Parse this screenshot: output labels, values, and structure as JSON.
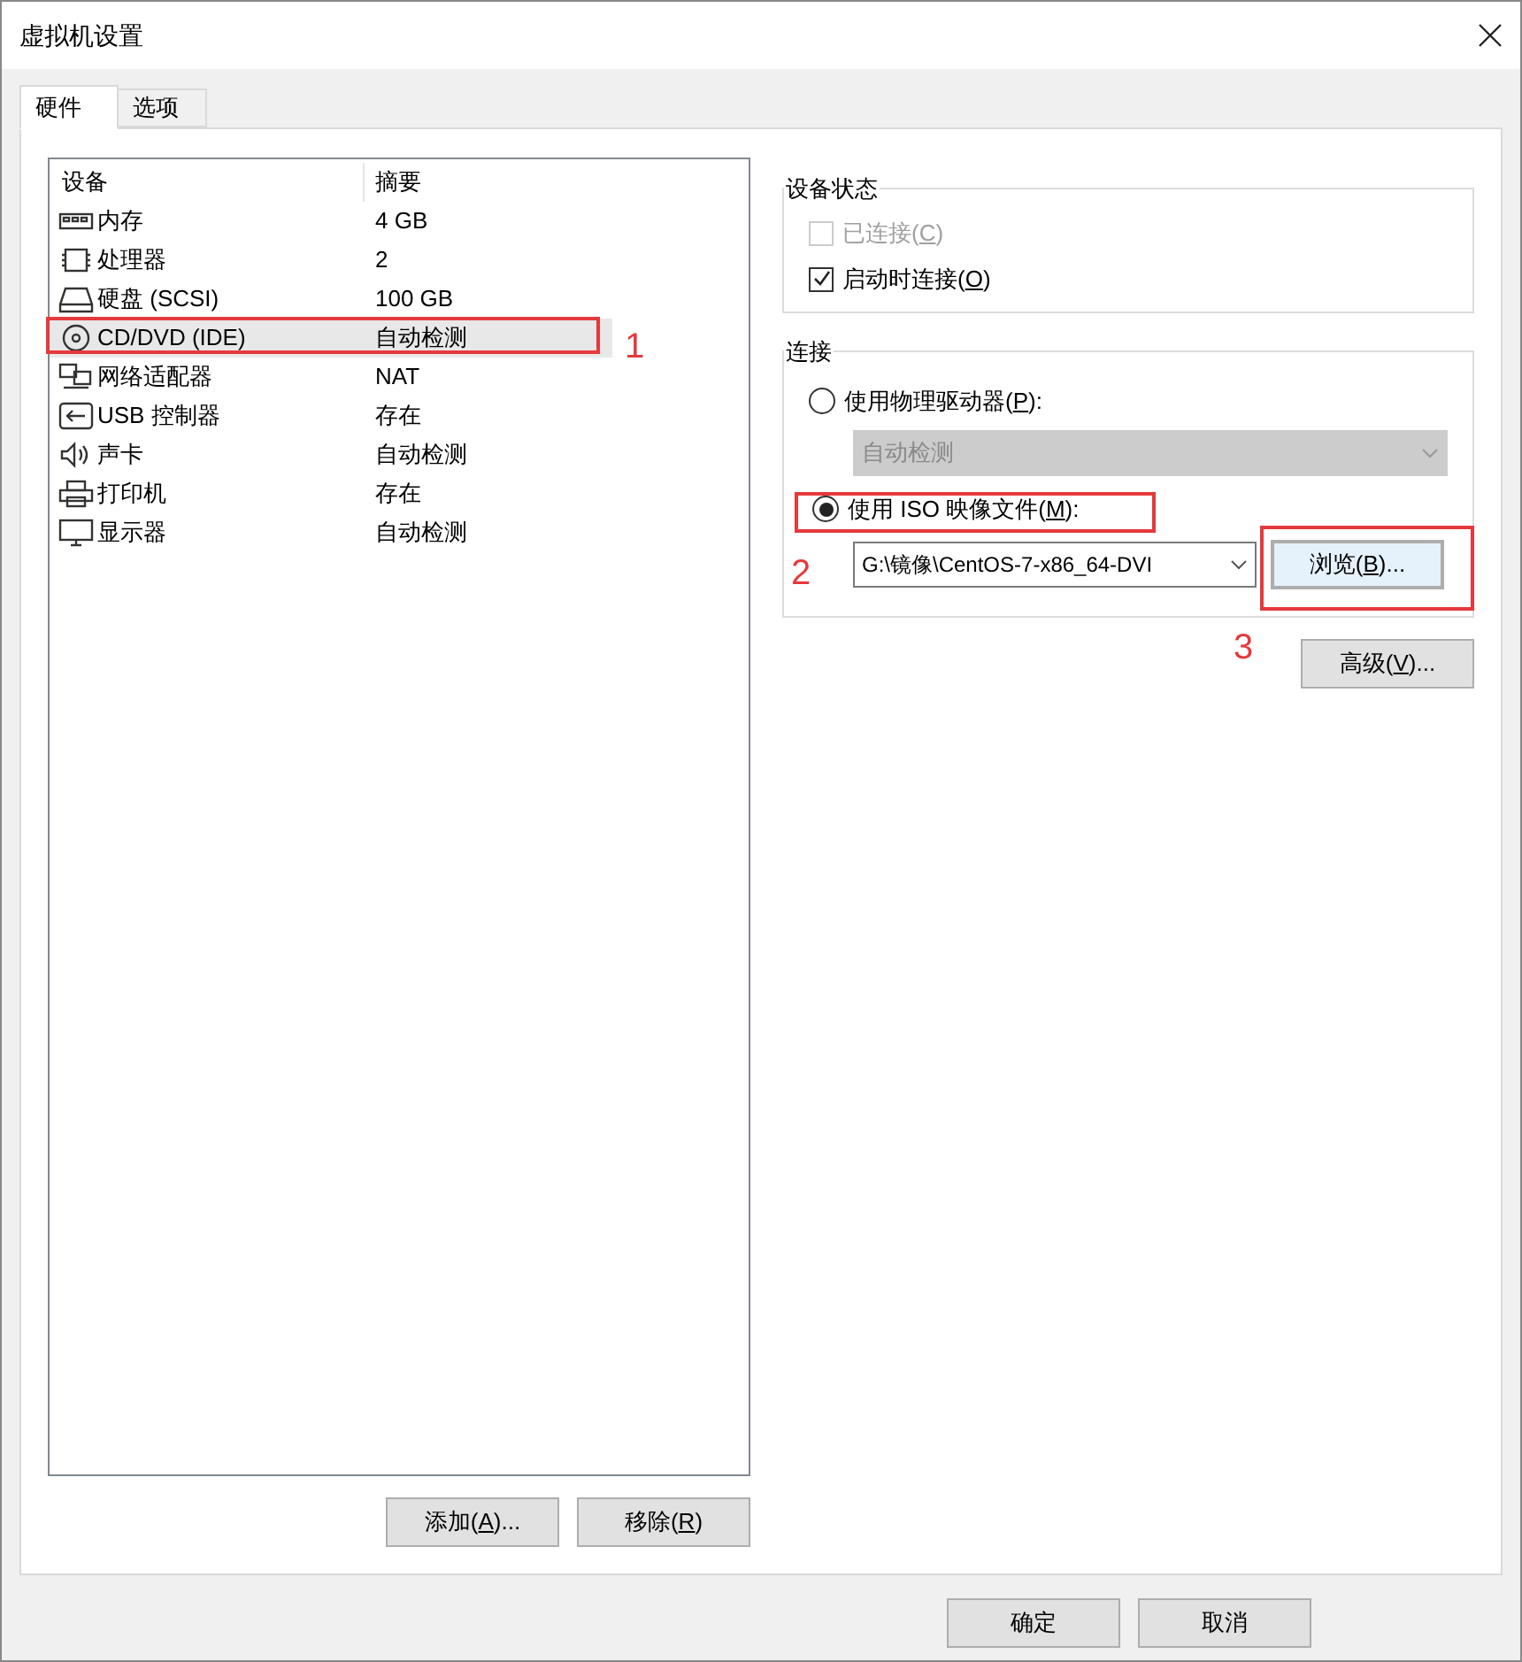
{
  "window": {
    "title": "虚拟机设置"
  },
  "tabs": [
    {
      "label": "硬件",
      "selected": true
    },
    {
      "label": "选项",
      "selected": false
    }
  ],
  "devices": {
    "columns": [
      "设备",
      "摘要"
    ],
    "rows": [
      {
        "kind": "memory",
        "name": "内存",
        "summary": "4 GB",
        "selected": false
      },
      {
        "kind": "cpu",
        "name": "处理器",
        "summary": "2",
        "selected": false
      },
      {
        "kind": "disk",
        "name": "硬盘 (SCSI)",
        "summary": "100 GB",
        "selected": false
      },
      {
        "kind": "cd",
        "name": "CD/DVD (IDE)",
        "summary": "自动检测",
        "selected": true
      },
      {
        "kind": "network",
        "name": "网络适配器",
        "summary": "NAT",
        "selected": false
      },
      {
        "kind": "usb",
        "name": "USB 控制器",
        "summary": "存在",
        "selected": false
      },
      {
        "kind": "sound",
        "name": "声卡",
        "summary": "自动检测",
        "selected": false
      },
      {
        "kind": "printer",
        "name": "打印机",
        "summary": "存在",
        "selected": false
      },
      {
        "kind": "display",
        "name": "显示器",
        "summary": "自动检测",
        "selected": false
      }
    ],
    "buttons": [
      {
        "before": "添加(",
        "key": "A",
        "after": ")..."
      },
      {
        "before": "移除(",
        "key": "R",
        "after": ")"
      }
    ]
  },
  "device_status": {
    "title": "设备状态",
    "options": [
      {
        "before": "已连接(",
        "key": "C",
        "after": ")",
        "checked": false,
        "disabled": true
      },
      {
        "before": "启动时连接(",
        "key": "O",
        "after": ")",
        "checked": true,
        "disabled": false
      }
    ]
  },
  "connection": {
    "title": "连接",
    "physical": {
      "before": "使用物理驱动器(",
      "key": "P",
      "after": "):",
      "selected": false,
      "drive": "自动检测",
      "disabled": true
    },
    "iso": {
      "before": "使用 ISO 映像文件(",
      "key": "M",
      "after": "):",
      "selected": true,
      "path": "G:\\镜像\\CentOS-7-x86_64-DVI"
    },
    "browse": {
      "before": "浏览(",
      "key": "B",
      "after": ")...",
      "focused": true
    }
  },
  "advanced": {
    "before": "高级(",
    "key": "V",
    "after": ")..."
  },
  "footer_buttons": [
    {
      "label": "确定"
    },
    {
      "label": "取消"
    }
  ],
  "annotations": [
    {
      "number": "1"
    },
    {
      "number": "2"
    },
    {
      "number": "3"
    }
  ]
}
